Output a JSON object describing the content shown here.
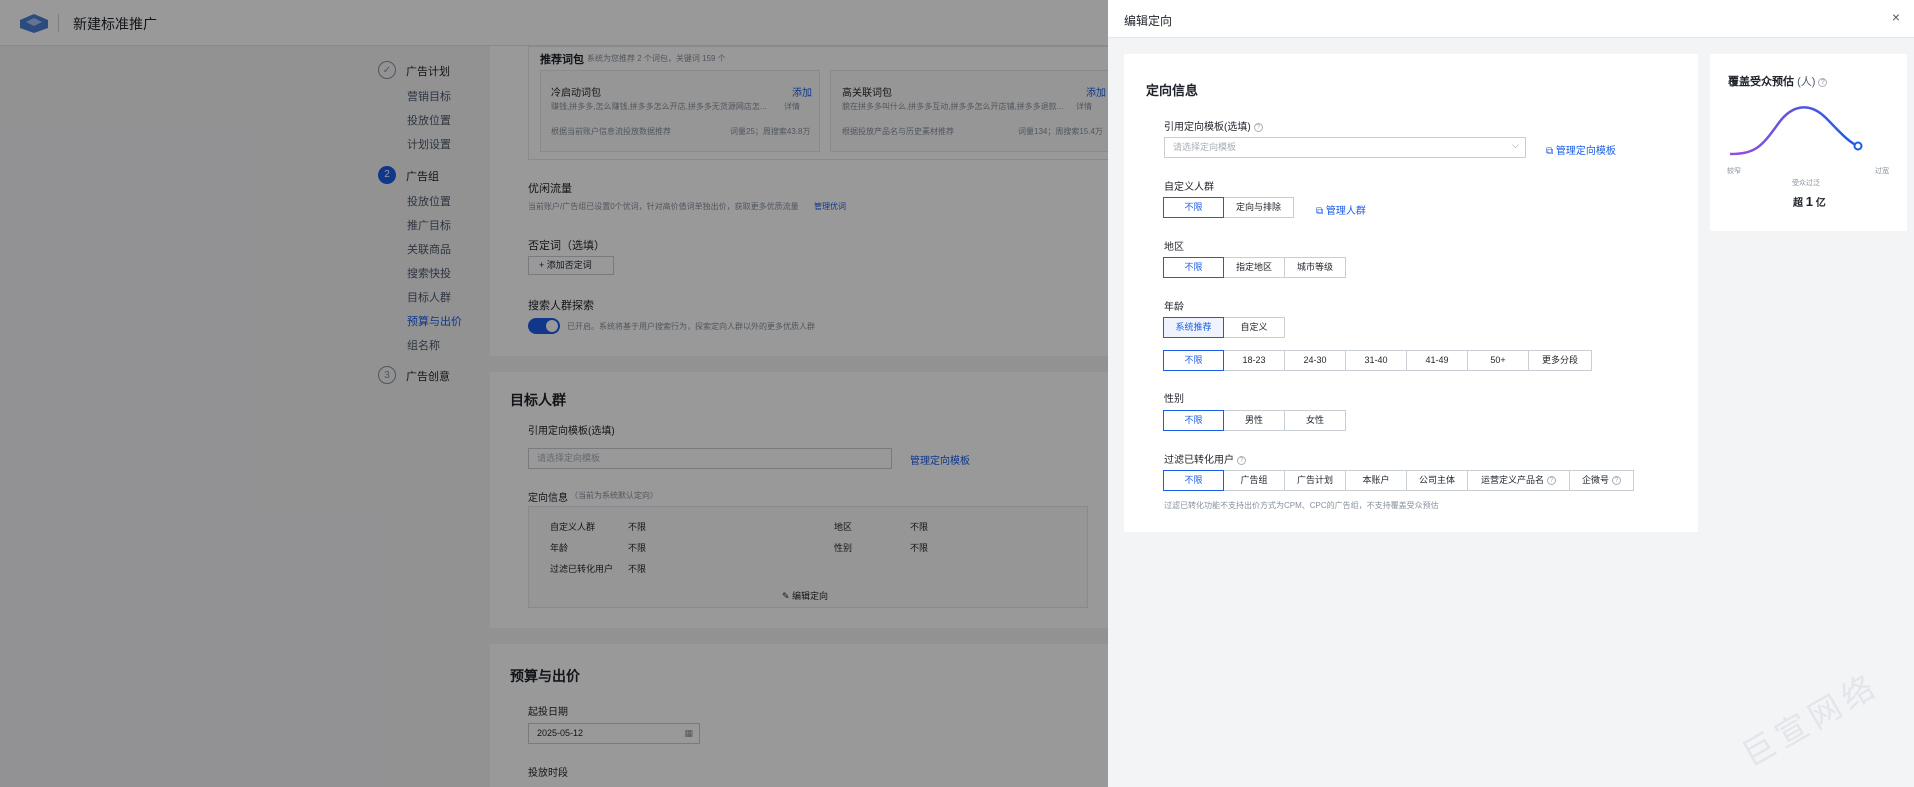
{
  "header": {
    "title": "新建标准推广"
  },
  "steps": [
    {
      "index": "✓",
      "label": "广告计划",
      "subs": [
        "营销目标",
        "投放位置",
        "计划设置"
      ]
    },
    {
      "index": "2",
      "label": "广告组",
      "subs": [
        "投放位置",
        "推广目标",
        "关联商品",
        "搜索快投",
        "目标人群",
        "预算与出价",
        "组名称"
      ]
    },
    {
      "index": "3",
      "label": "广告创意"
    }
  ],
  "bg": {
    "rec_title": "推荐词包",
    "rec_desc": "系统为您推荐 2 个词包，关键词 159 个",
    "pack1": {
      "name": "冷启动词包",
      "add": "添加",
      "words": "赚钱,拼多多,怎么赚钱,拼多多怎么开店,拼多多无货源网店怎...",
      "detail": "详情",
      "basis": "根据当前账户信息流投放数据推荐",
      "stat": "词量25；周搜索43.8万"
    },
    "pack2": {
      "name": "高关联词包",
      "add": "添加",
      "words": "貌在拼多多叫什么,拼多多互动,拼多多怎么开店铺,拼多多退款...",
      "detail": "详情",
      "basis": "根据投放产品名与历史素材推荐",
      "stat": "词量134；周搜索15.4万"
    },
    "premium": "优闲流量",
    "premium_desc": "当前账户/广告组已设置0个优词，针对高价值词单独出价，获取更多优质流量",
    "premium_link": "管理优词",
    "neg_label": "否定词（选填）",
    "neg_btn": "+ 添加否定词",
    "explore_label": "搜索人群探索",
    "explore_desc": "已开启。系统将基于用户搜索行为，探索定向人群以外的更多优质人群",
    "target_title": "目标人群",
    "tpl_label": "引用定向模板(选填)",
    "tpl_placeholder": "请选择定向模板",
    "tpl_manage": "管理定向模板",
    "info_label": "定向信息",
    "info_note": "（当前为系统默认定向）",
    "info_rows": [
      [
        "自定义人群",
        "不限",
        "地区",
        "不限"
      ],
      [
        "年龄",
        "不限",
        "性别",
        "不限"
      ],
      [
        "过滤已转化用户",
        "不限",
        "",
        ""
      ]
    ],
    "edit_link": "编辑定向",
    "budget_title": "预算与出价",
    "start_label": "起投日期",
    "start_value": "2025-05-12",
    "period_label": "投放时段"
  },
  "drawer": {
    "title": "编辑定向",
    "close": "×",
    "section_title": "定向信息",
    "template": {
      "label": "引用定向模板(选填)",
      "placeholder": "请选择定向模板",
      "manage": "管理定向模板"
    },
    "custom": {
      "label": "自定义人群",
      "options": [
        "不限",
        "定向与排除"
      ],
      "selected": 0,
      "manage": "管理人群"
    },
    "region": {
      "label": "地区",
      "options": [
        "不限",
        "指定地区",
        "城市等级"
      ],
      "selected": 0
    },
    "age": {
      "label": "年龄",
      "modes": [
        "系统推荐",
        "自定义"
      ],
      "mode_selected": 0,
      "options": [
        "不限",
        "18-23",
        "24-30",
        "31-40",
        "41-49",
        "50+",
        "更多分段"
      ],
      "selected": 0
    },
    "gender": {
      "label": "性别",
      "options": [
        "不限",
        "男性",
        "女性"
      ],
      "selected": 0
    },
    "filter": {
      "label": "过滤已转化用户",
      "options": [
        "不限",
        "广告组",
        "广告计划",
        "本账户",
        "公司主体",
        "运营定义产品名",
        "企微号"
      ],
      "selected": 0,
      "note": "过滤已转化功能不支持出价方式为CPM、CPC的广告组，不支持覆盖受众预估"
    },
    "estimate": {
      "title": "覆盖受众预估",
      "unit": "(人)",
      "left": "较窄",
      "right": "过宽",
      "center": "受众过泛",
      "prefix": "超",
      "value": "1",
      "suffix": "亿",
      "level": 0.95
    }
  },
  "watermark": "巨宣网络",
  "colors": {
    "primary": "#1b5ce6",
    "curve_start": "#9b4de0",
    "curve_end": "#1b5ce6"
  }
}
